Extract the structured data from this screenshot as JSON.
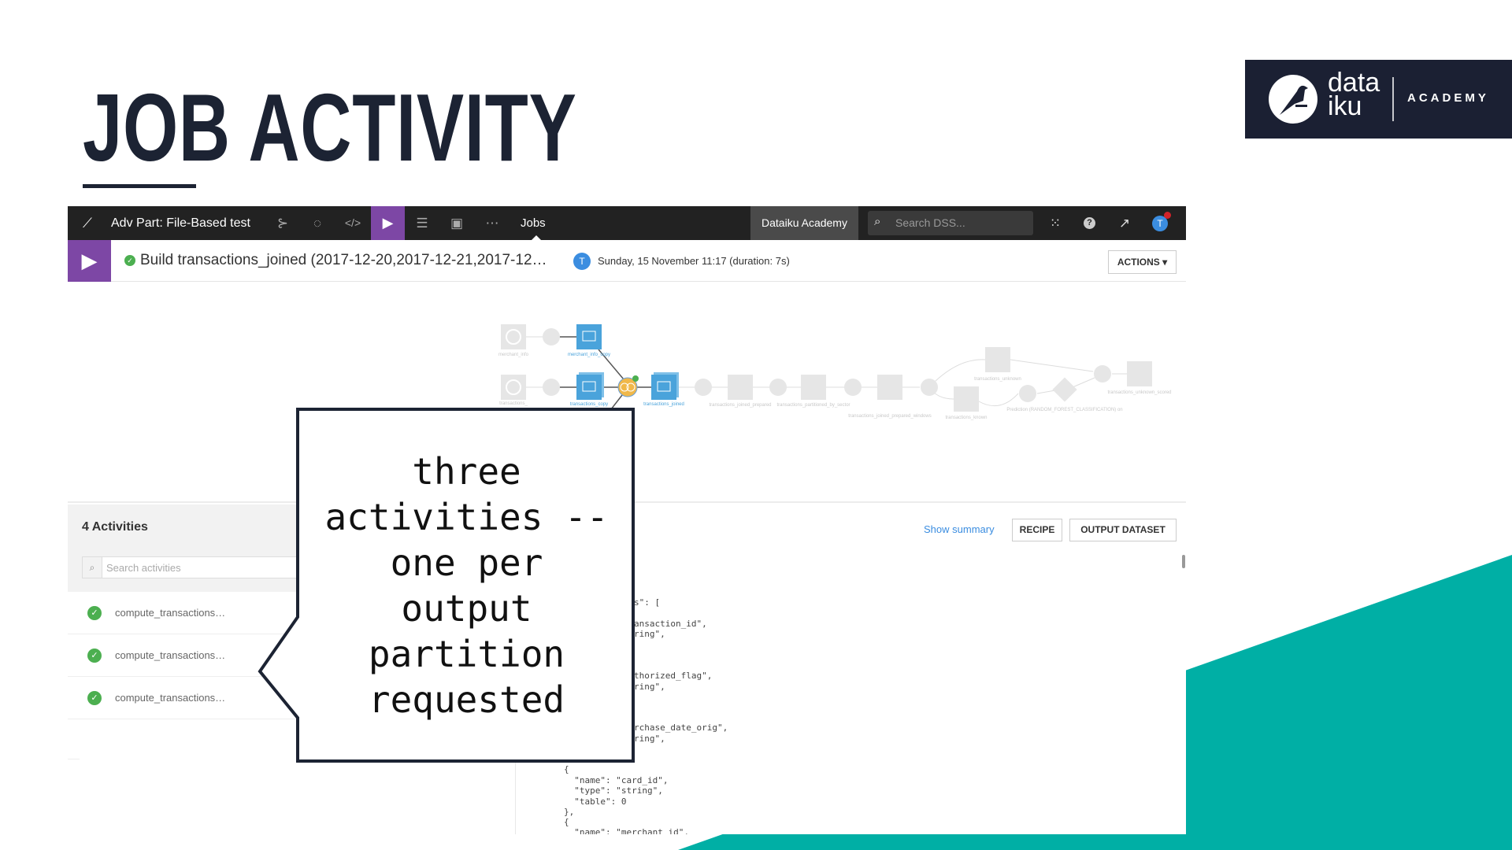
{
  "slide": {
    "title": "JOB ACTIVITY",
    "accent_color": "#00afa5",
    "title_color": "#1c2333",
    "logo": {
      "brand_line1": "data",
      "brand_line2": "iku",
      "tagline": "ACADEMY"
    }
  },
  "toolbar": {
    "project_name": "Adv Part: File-Based test",
    "icons": [
      "dataiku-bird-icon",
      "flow-icon",
      "refresh-icon",
      "code-icon",
      "play-icon",
      "stack-icon",
      "dashboard-icon",
      "more-icon"
    ],
    "jobs_label": "Jobs",
    "instance_label": "Dataiku Academy",
    "search_placeholder": "Search DSS...",
    "avatar_letter": "T"
  },
  "job": {
    "status": "success",
    "title": "Build transactions_joined (2017-12-20,2017-12-21,2017-12…",
    "user_initial": "T",
    "timestamp": "Sunday, 15 November 11:17 (duration: 7s)",
    "actions_label": "ACTIONS"
  },
  "flow": {
    "nodes": {
      "merchant_info": "merchant_info",
      "merchant_info_copy": "merchant_info_copy",
      "transactions": "transactions_",
      "transactions_copy": "transactions_copy",
      "transactions_joined": "transactions_joined",
      "prepared": "transactions_joined_prepared",
      "partitioned": "transactions_partitioned_by_sector",
      "windows": "transactions_joined_prepared_windows",
      "unknown": "transactions_unknown",
      "known": "transactions_known",
      "model": "Prediction (RANDOM_FOREST_CLASSIFICATION) on",
      "scored": "transactions_unknown_scored"
    }
  },
  "activities": {
    "heading": "4 Activities",
    "search_placeholder": "Search activities",
    "items": [
      {
        "name": "compute_transactions…",
        "status": "success"
      },
      {
        "name": "compute_transactions…",
        "status": "success"
      },
      {
        "name": "compute_transactions…",
        "status": "success"
      }
    ]
  },
  "detail": {
    "show_summary": "Show summary",
    "recipe_label": "RECIPE",
    "output_dataset_label": "OUTPUT DATASET",
    "code_lines": [
      "s\": [",
      "ansaction_id\",",
      "ring\",",
      "thorized_flag\",",
      "ring\",",
      "rchase_date_orig\",",
      "ring\",",
      "{",
      "  \"name\": \"card_id\",",
      "  \"type\": \"string\",",
      "  \"table\": 0",
      "},",
      "{",
      "  \"name\": \"merchant_id\","
    ]
  },
  "callout": {
    "lines": [
      "three",
      "activities --",
      "one per",
      "output",
      "partition",
      "requested"
    ]
  }
}
